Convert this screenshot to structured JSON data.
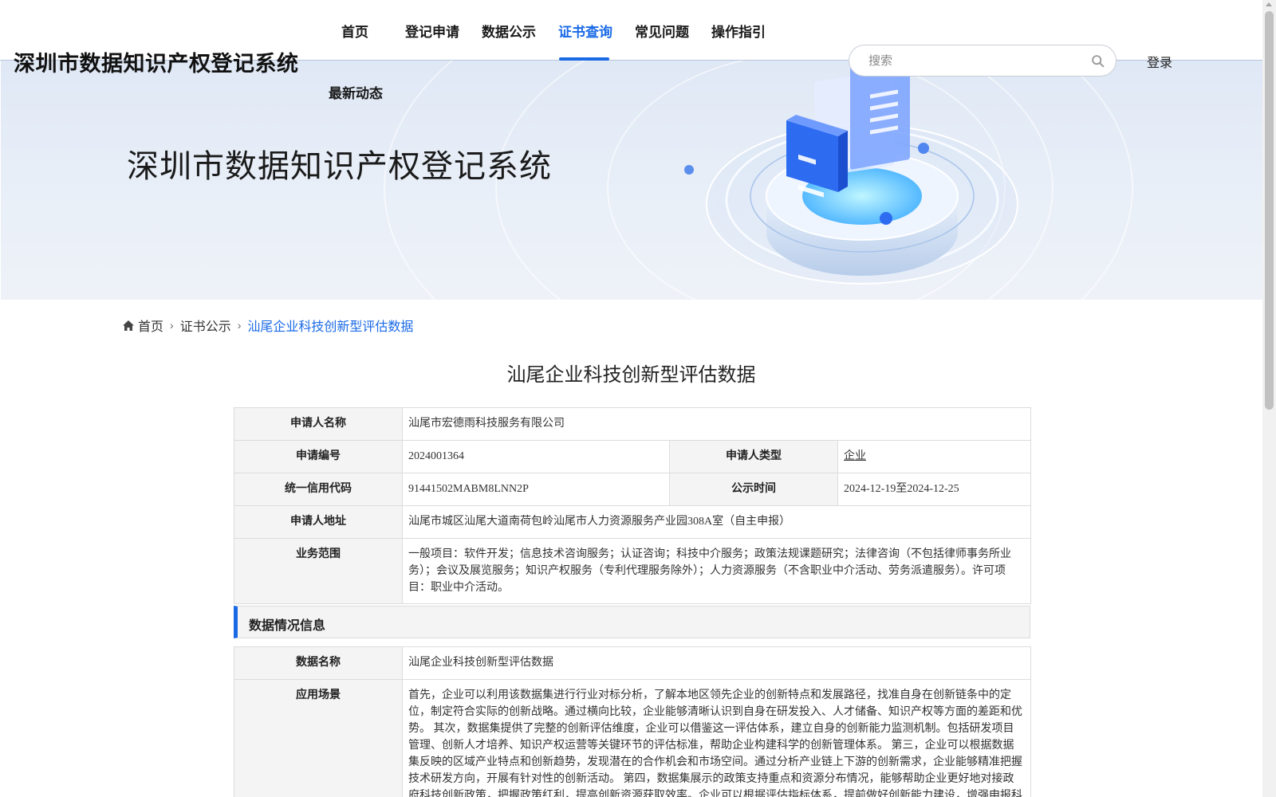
{
  "header": {
    "site_title": "深圳市数据知识产权登记系统",
    "nav": [
      {
        "label": "首页",
        "active": false
      },
      {
        "label": "登记申请",
        "active": false
      },
      {
        "label": "数据公示",
        "active": false
      },
      {
        "label": "证书查询",
        "active": true
      },
      {
        "label": "常见问题",
        "active": false
      },
      {
        "label": "操作指引",
        "active": false
      },
      {
        "label": "最新动态",
        "active": false
      }
    ],
    "search_placeholder": "搜索",
    "login_label": "登录",
    "accent_color": "#1a6ae6"
  },
  "banner": {
    "title": "深圳市数据知识产权登记系统"
  },
  "breadcrumb": {
    "home": "首页",
    "level1": "证书公示",
    "current": "汕尾企业科技创新型评估数据"
  },
  "page_title": "汕尾企业科技创新型评估数据",
  "applicant": {
    "name_label": "申请人名称",
    "name": "汕尾市宏德雨科技服务有限公司",
    "number_label": "申请编号",
    "number": "2024001364",
    "type_label": "申请人类型",
    "type": "企业",
    "credit_label": "统一信用代码",
    "credit_code": "91441502MABM8LNN2P",
    "publish_label": "公示时间",
    "publish_time": "2024-12-19至2024-12-25",
    "address_label": "申请人地址",
    "address": "汕尾市城区汕尾大道南荷包岭汕尾市人力资源服务产业园308A室（自主申报）",
    "scope_label": "业务范围",
    "scope": "一般项目：软件开发；信息技术咨询服务；认证咨询；科技中介服务；政策法规课题研究；法律咨询（不包括律师事务所业务）；会议及展览服务；知识产权服务（专利代理服务除外）；人力资源服务（不含职业中介活动、劳务派遣服务）。许可项目：职业中介活动。"
  },
  "data_section": {
    "title": "数据情况信息",
    "name_label": "数据名称",
    "name": "汕尾企业科技创新型评估数据",
    "scenario_label": "应用场景",
    "scenario": "首先，企业可以利用该数据集进行行业对标分析，了解本地区领先企业的创新特点和发展路径，找准自身在创新链条中的定位，制定符合实际的创新战略。通过横向比较，企业能够清晰认识到自身在研发投入、人才储备、知识产权等方面的差距和优势。 其次，数据集提供了完整的创新评估维度，企业可以借鉴这一评估体系，建立自身的创新能力监测机制。包括研发项目管理、创新人才培养、知识产权运营等关键环节的评估标准，帮助企业构建科学的创新管理体系。 第三，企业可以根据数据集反映的区域产业特点和创新趋势，发现潜在的合作机会和市场空间。通过分析产业链上下游的创新需求，企业能够精准把握技术研发方向，开展有针对性的创新活动。 第四，数据集展示的政策支持重点和资源分布情况，能够帮助企业更好地对接政府科技创新政策，把握政策红利，提高创新资源获取效率。企业可以根据评估指标体系，提前做好创新能力建设，增强申报科"
  }
}
